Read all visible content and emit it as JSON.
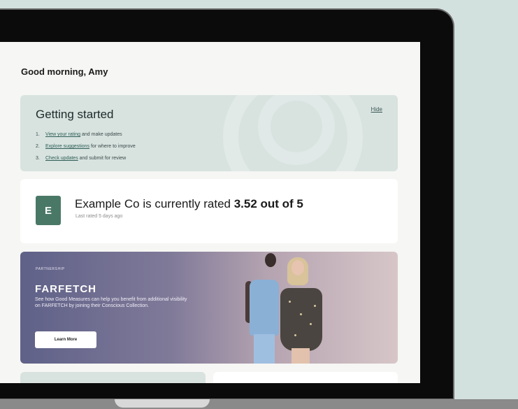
{
  "greeting": "Good morning, Amy",
  "getting_started": {
    "title": "Getting started",
    "hide_label": "Hide",
    "steps": [
      {
        "num": "1.",
        "link": "View your rating",
        "rest": " and make updates"
      },
      {
        "num": "2.",
        "link": "Explore suggestions",
        "rest": " for where to improve"
      },
      {
        "num": "3.",
        "link": "Check updates",
        "rest": " and submit for review"
      }
    ]
  },
  "rating_card": {
    "avatar_letter": "E",
    "text_prefix": "Example Co is currently rated ",
    "rating_value": "3.52 out of 5",
    "subtext": "Last rated 5 days ago"
  },
  "promo": {
    "tag": "PARTNERSHIP",
    "brand": "FARFETCH",
    "description": "See how Good Measures can help you benefit from additional visibility on FARFETCH by joining their Conscious Collection.",
    "button_label": "Learn More"
  },
  "colors": {
    "background": "#d3e1de",
    "accent": "#4a7867",
    "card_tint": "#d8e3e0"
  }
}
